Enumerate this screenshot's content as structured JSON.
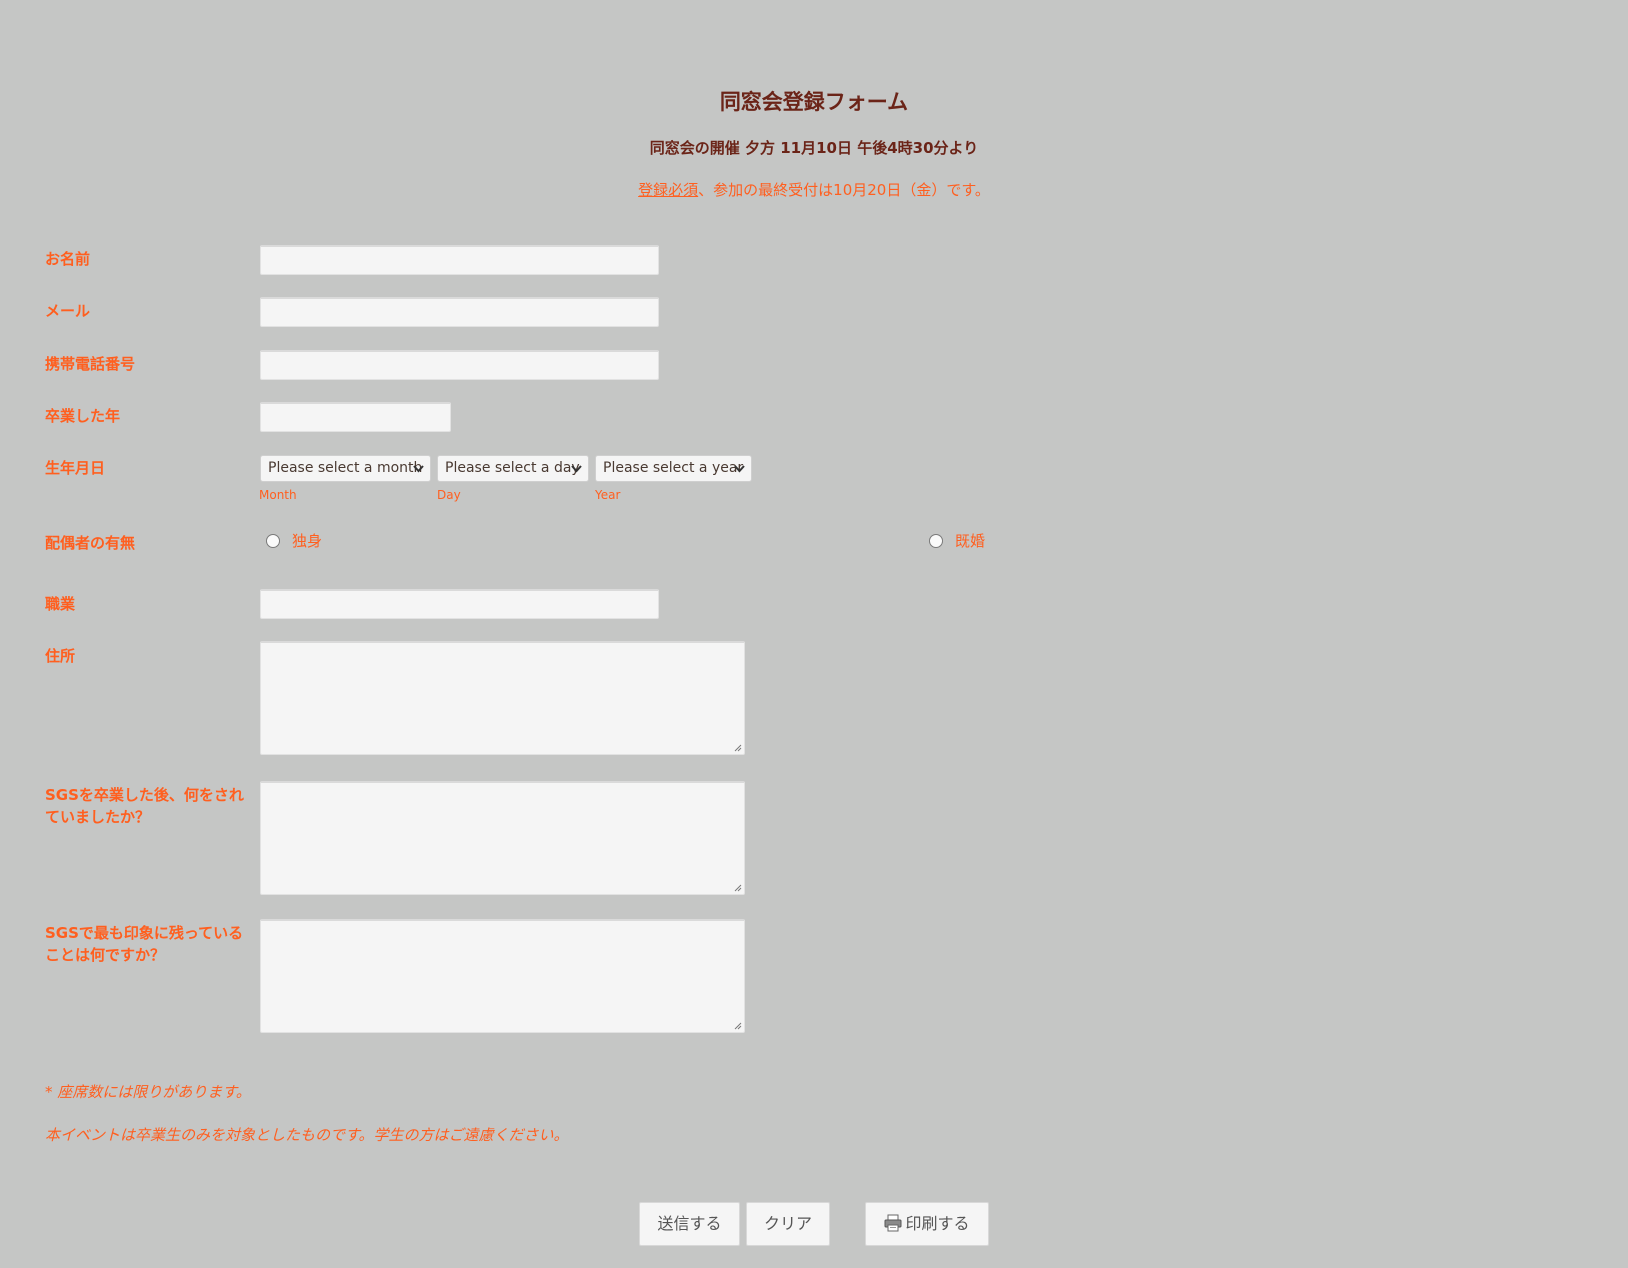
{
  "form": {
    "title": "同窓会登録フォーム",
    "subtitle": "同窓会の開催 夕方 11月10日 午後4時30分より",
    "notice_required": "登録必須",
    "notice_rest": "、参加の最終受付は10月20日（金）です。"
  },
  "fields": {
    "name_label": "お名前",
    "email_label": "メール",
    "phone_label": "携帯電話番号",
    "grad_year_label": "卒業した年",
    "birthday_label": "生年月日",
    "marital_label": "配偶者の有無",
    "occupation_label": "職業",
    "address_label": "住所",
    "after_sgs_label": "SGSを卒業した後、何をされていましたか？",
    "memory_label": "SGSで最も印象に残っていることは何ですか？"
  },
  "birthday": {
    "month_placeholder": "Please select a month",
    "day_placeholder": "Please select a day",
    "year_placeholder": "Please select a year",
    "month_sublabel": "Month",
    "day_sublabel": "Day",
    "year_sublabel": "Year"
  },
  "marital": {
    "single": "独身",
    "married": "既婚"
  },
  "notes": {
    "seats": "* 座席数には限りがあります。",
    "graduates_only": "本イベントは卒業生のみを対象としたものです。学生の方はご遠慮ください。"
  },
  "buttons": {
    "submit": "送信する",
    "clear": "クリア",
    "print": "印刷する"
  },
  "colors": {
    "background": "#c5c6c5",
    "title": "#6b2418",
    "accent": "#ff5f1f"
  }
}
